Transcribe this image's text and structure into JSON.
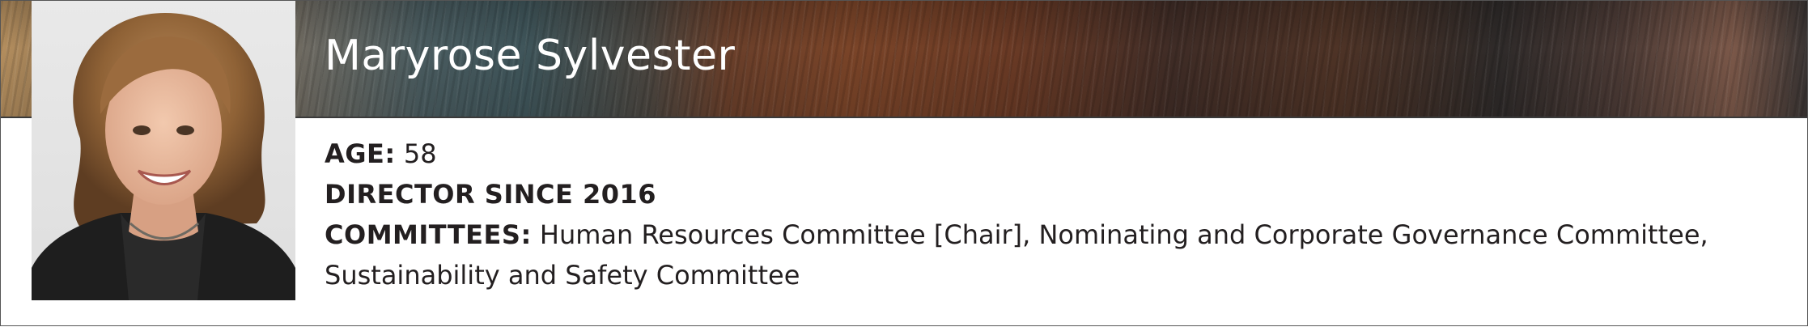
{
  "profile": {
    "name": "Maryrose Sylvester",
    "age_label": "AGE:",
    "age_value": "58",
    "director_since": "DIRECTOR SINCE 2016",
    "committees_label": "COMMITTEES:",
    "committees_line1": "Human Resources Committee [Chair], Nominating and Corporate Governance Committee,",
    "committees_line2": "Sustainability and Safety Committee"
  },
  "colors": {
    "text": "#231f20",
    "name_text": "#ffffff",
    "border": "#555555"
  }
}
